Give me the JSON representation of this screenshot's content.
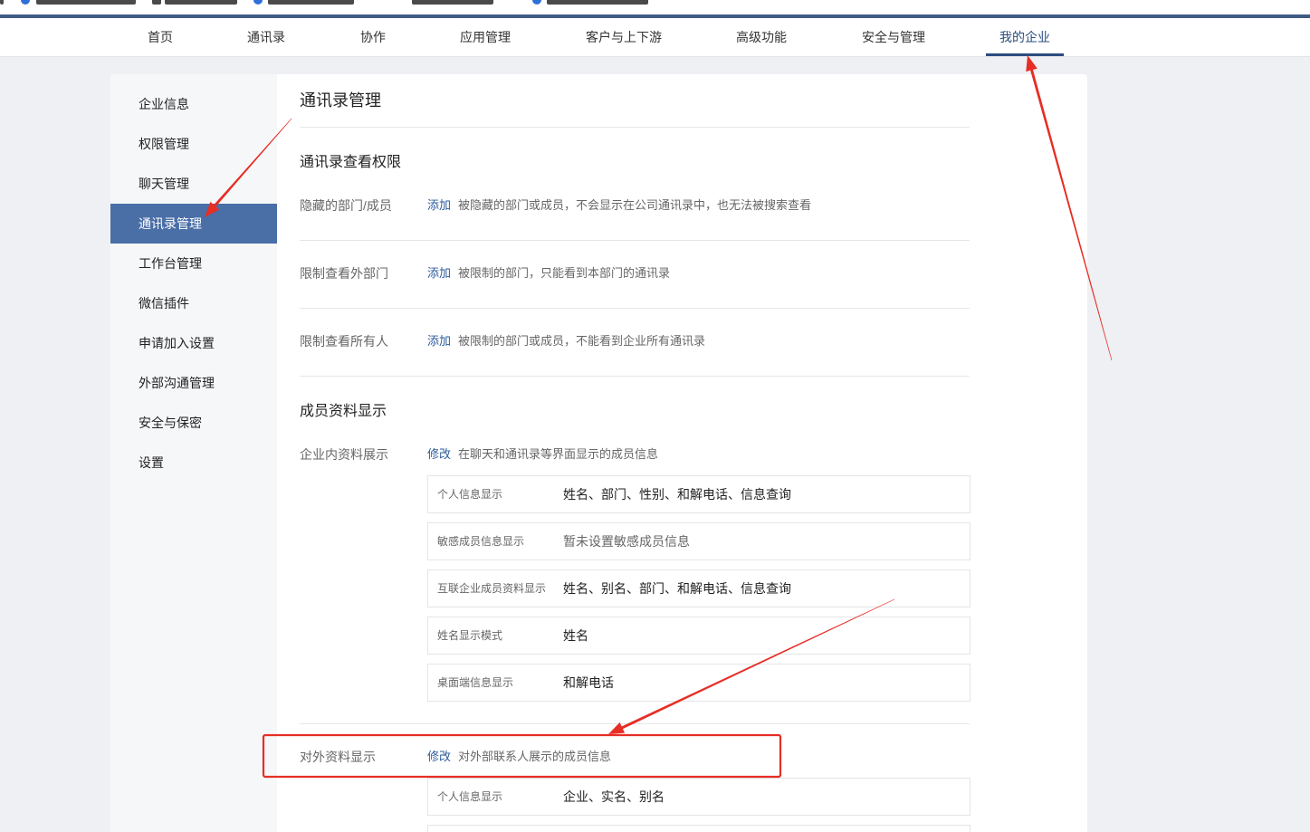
{
  "nav": {
    "items": [
      "首页",
      "通讯录",
      "协作",
      "应用管理",
      "客户与上下游",
      "高级功能",
      "安全与管理",
      "我的企业"
    ],
    "active_index": 7
  },
  "sidebar": {
    "items": [
      "企业信息",
      "权限管理",
      "聊天管理",
      "通讯录管理",
      "工作台管理",
      "微信插件",
      "申请加入设置",
      "外部沟通管理",
      "安全与保密",
      "设置"
    ],
    "active_index": 3
  },
  "content": {
    "title": "通讯录管理",
    "view_permission": {
      "heading": "通讯录查看权限",
      "rows": [
        {
          "label": "隐藏的部门/成员",
          "action": "添加",
          "desc": "被隐藏的部门或成员，不会显示在公司通讯录中，也无法被搜索查看"
        },
        {
          "label": "限制查看外部门",
          "action": "添加",
          "desc": "被限制的部门，只能看到本部门的通讯录"
        },
        {
          "label": "限制查看所有人",
          "action": "添加",
          "desc": "被限制的部门或成员，不能看到企业所有通讯录"
        }
      ]
    },
    "member_profile": {
      "heading": "成员资料显示",
      "internal": {
        "label": "企业内资料展示",
        "action": "修改",
        "desc": "在聊天和通讯录等界面显示的成员信息",
        "fields": [
          {
            "name": "个人信息显示",
            "value": "姓名、部门、性别、和解电话、信息查询"
          },
          {
            "name": "敏感成员信息显示",
            "value": "暂未设置敏感成员信息"
          },
          {
            "name": "互联企业成员资料显示",
            "value": "姓名、别名、部门、和解电话、信息查询"
          },
          {
            "name": "姓名显示模式",
            "value": "姓名"
          },
          {
            "name": "桌面端信息显示",
            "value": "和解电话"
          }
        ]
      },
      "external": {
        "label": "对外资料显示",
        "action": "修改",
        "desc": "对外部联系人展示的成员信息",
        "fields": [
          {
            "name": "个人信息显示",
            "value": "企业、实名、别名"
          }
        ]
      }
    }
  },
  "colors": {
    "top_bar": "#3f5b84",
    "nav_active": "#2b4d80",
    "sidebar_active_bg": "#4a6ea6",
    "link": "#2d5c9c",
    "annotation_red": "#e62e25",
    "page_bg": "#eef0f3"
  }
}
